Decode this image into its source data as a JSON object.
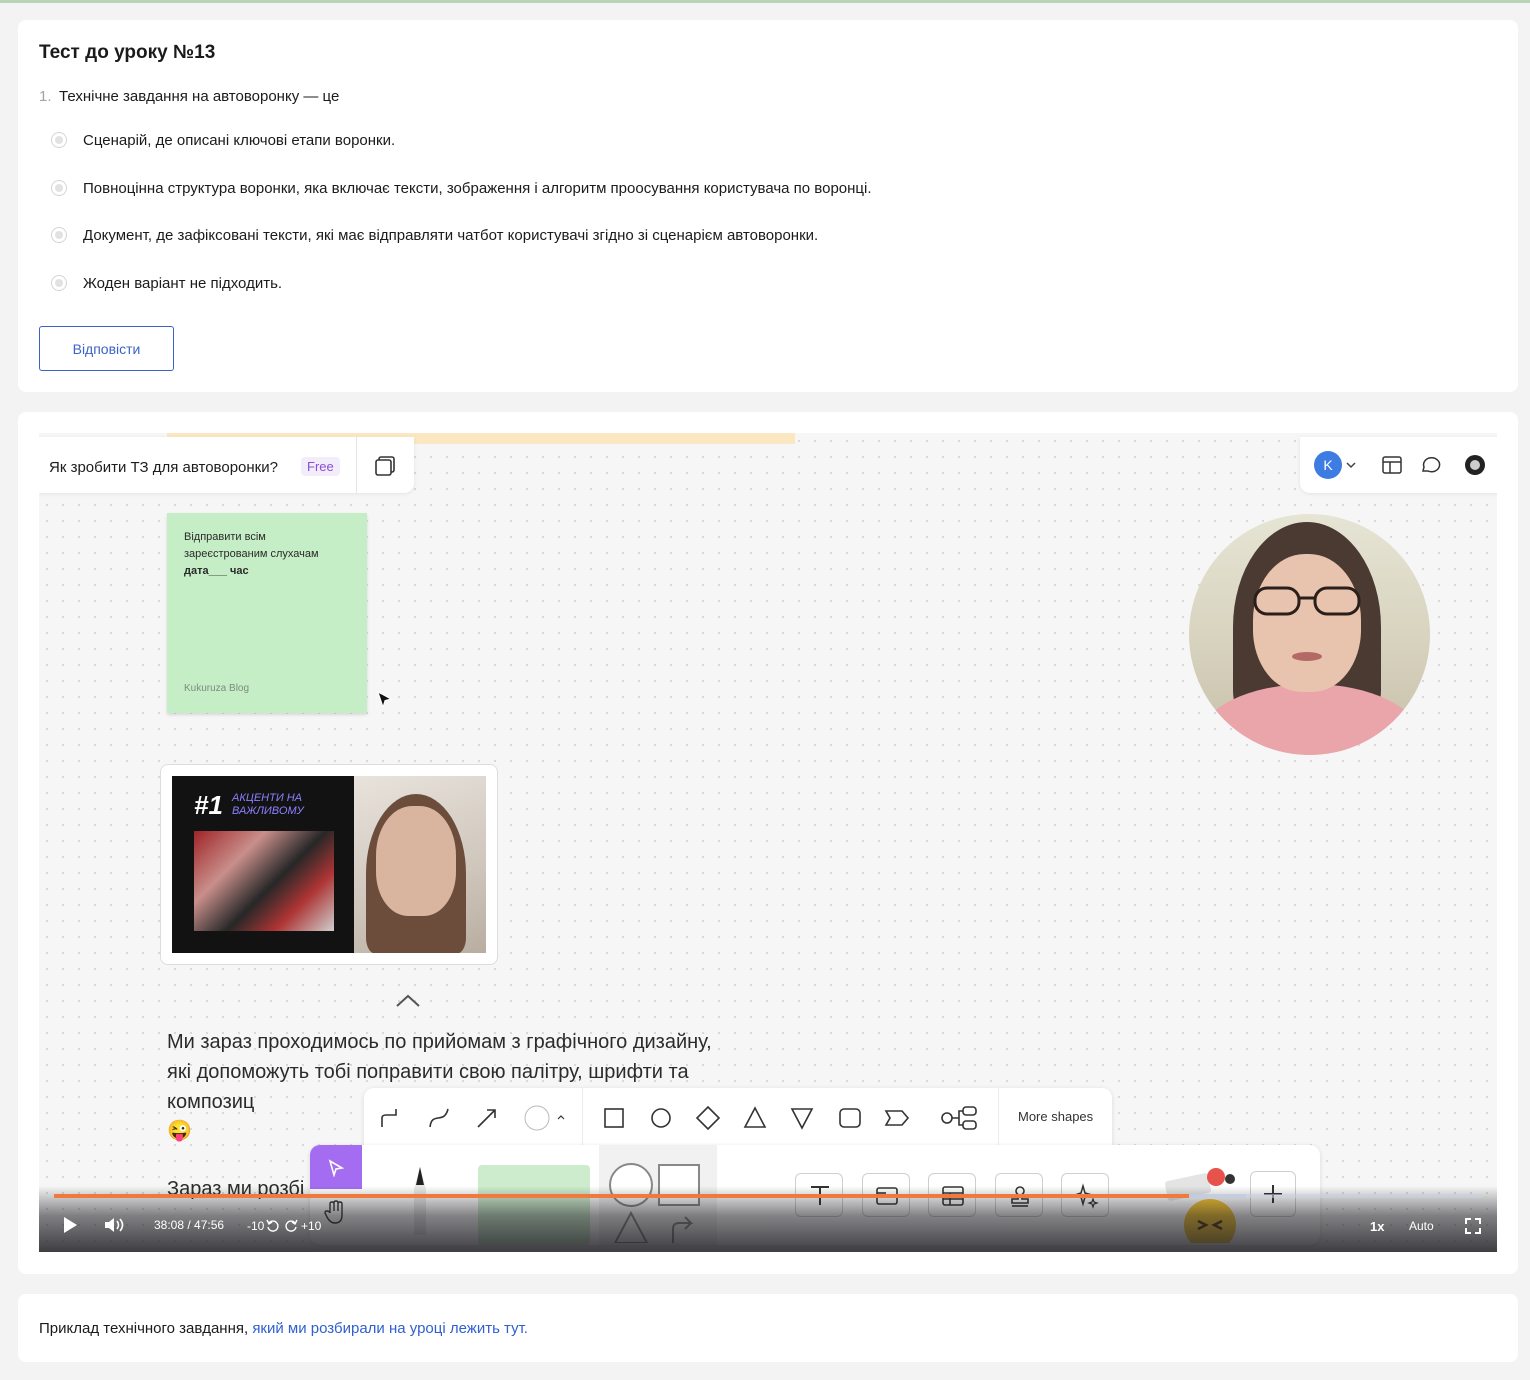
{
  "quiz": {
    "title": "Тест до уроку №13",
    "question_number": "1.",
    "question": "Технічне завдання на автоворонку — це",
    "options": [
      "Сценарій, де описані ключові етапи воронки.",
      "Повноцінна структура воронки, яка включає тексти, зображення і алгоритм проосування користувача по воронці.",
      "Документ, де зафіксовані тексти, які має відправляти чатбот користувачі згідно зі сценарієм автоворонки.",
      "Жоден варіант не підходить."
    ],
    "answer_button": "Відповісти"
  },
  "video": {
    "board_title": "Як зробити ТЗ для автоворонки?",
    "board_badge": "Free",
    "user_initial": "K",
    "sticky_note": {
      "line1": "Відправити всім",
      "line2": "зареєстрованим слухачам",
      "line3": "дата___ час",
      "footer": "Kukuruza Blog"
    },
    "thumbnail": {
      "title": "#1",
      "subtitle": "АКЦЕНТИ НА ВАЖЛИВОМУ"
    },
    "caption_text": "Ми зараз проходимось по прийомам з графічного дизайну, які допоможуть тобі поправити свою палітру, шрифти та композиц",
    "caption_emoji": "😜",
    "caption_text2": "Зараз ми розбі",
    "shapes_bar": {
      "more_shapes": "More shapes"
    },
    "player": {
      "current_time": "38:08",
      "duration": "47:56",
      "time_display": "38:08 / 47:56",
      "seek_back": "-10",
      "seek_forward": "+10",
      "playback_rate": "1x",
      "quality": "Auto",
      "progress_fraction": 0.795,
      "buffered_fraction": 0.835
    },
    "colors": {
      "progress": "#f07a3e",
      "select_tool": "#a46cf0",
      "sticky": "#c5eec7",
      "avatar": "#3d7de3"
    }
  },
  "note": {
    "text": "Приклад технічного завдання, ",
    "link_text": "який ми розбирали на уроці лежить тут."
  }
}
